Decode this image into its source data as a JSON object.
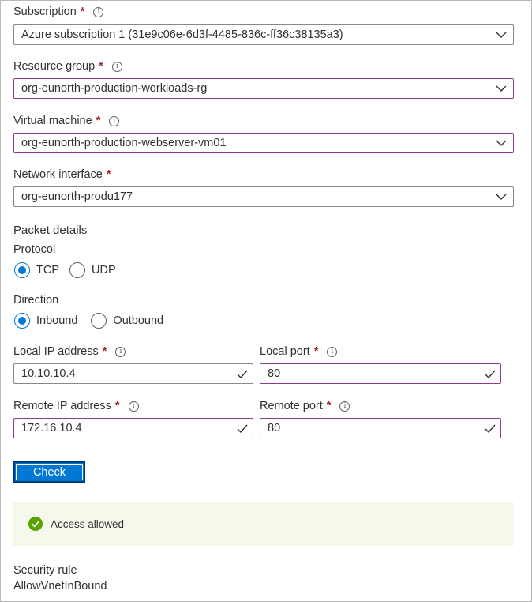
{
  "subscription": {
    "label": "Subscription",
    "required": "*",
    "info": "i",
    "value": "Azure subscription 1 (31e9c06e-6d3f-4485-836c-ff36c38135a3)"
  },
  "resource_group": {
    "label": "Resource group",
    "required": "*",
    "info": "i",
    "value": "org-eunorth-production-workloads-rg"
  },
  "virtual_machine": {
    "label": "Virtual machine",
    "required": "*",
    "info": "i",
    "value": "org-eunorth-production-webserver-vm01"
  },
  "network_interface": {
    "label": "Network interface",
    "required": "*",
    "value": "org-eunorth-produ177"
  },
  "packet_details": {
    "title": "Packet details"
  },
  "protocol": {
    "label": "Protocol",
    "options": [
      "TCP",
      "UDP"
    ],
    "selected": "TCP"
  },
  "direction": {
    "label": "Direction",
    "options": [
      "Inbound",
      "Outbound"
    ],
    "selected": "Inbound"
  },
  "local_ip": {
    "label": "Local IP address",
    "required": "*",
    "info": "i",
    "value": "10.10.10.4"
  },
  "local_port": {
    "label": "Local port",
    "required": "*",
    "info": "i",
    "value": "80"
  },
  "remote_ip": {
    "label": "Remote IP address",
    "required": "*",
    "info": "i",
    "value": "172.16.10.4"
  },
  "remote_port": {
    "label": "Remote port",
    "required": "*",
    "info": "i",
    "value": "80"
  },
  "check_button": {
    "label": "Check"
  },
  "result": {
    "text": "Access allowed"
  },
  "security_rule": {
    "label": "Security rule",
    "value": "AllowVnetInBound"
  },
  "colors": {
    "accent": "#0078d4",
    "focus_border": "#8e3a8e",
    "success": "#57a300",
    "required": "#a4262c",
    "status_bg": "#f4f9ec"
  }
}
